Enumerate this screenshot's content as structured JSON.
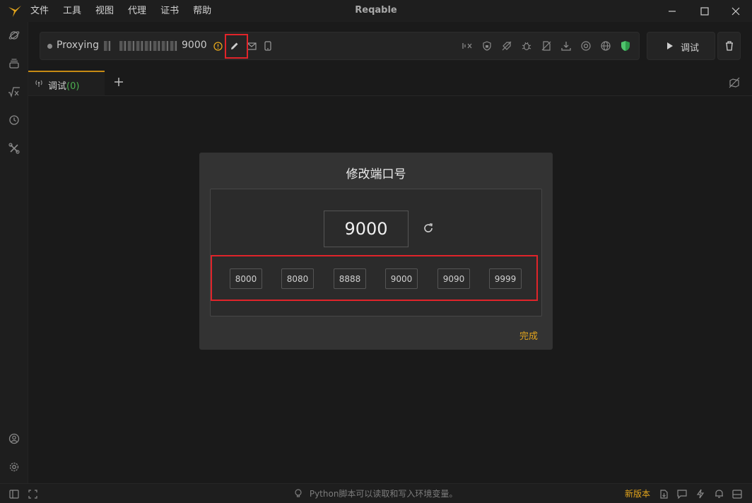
{
  "app": {
    "title": "Reqable"
  },
  "menu": [
    "文件",
    "工具",
    "视图",
    "代理",
    "证书",
    "帮助"
  ],
  "proxy": {
    "label": "Proxying",
    "port": "9000"
  },
  "toolbar": {
    "debug_label": "调试"
  },
  "tabs": [
    {
      "label": "调试",
      "count": "(0)"
    }
  ],
  "modal": {
    "title": "修改端口号",
    "port_value": "9000",
    "presets": [
      "8000",
      "8080",
      "8888",
      "9000",
      "9090",
      "9999"
    ],
    "done_label": "完成"
  },
  "status": {
    "tip": "Python脚本可以读取和写入环境变量。",
    "new_version": "新版本"
  },
  "colors": {
    "accent": "#e2a41c",
    "highlight": "#e0242a",
    "success": "#4caf50"
  }
}
